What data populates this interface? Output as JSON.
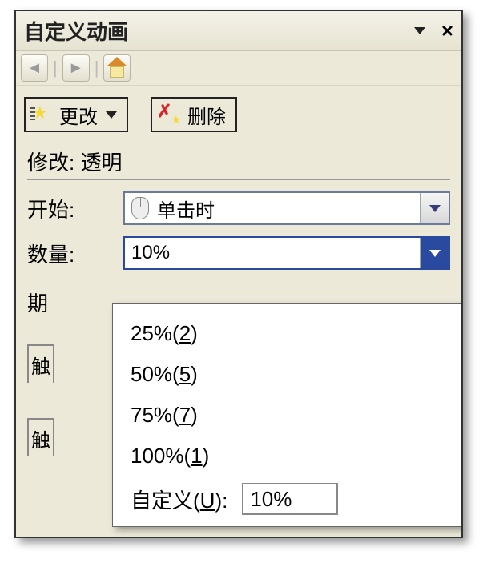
{
  "titlebar": {
    "title": "自定义动画"
  },
  "actions": {
    "change_label": "更改",
    "delete_label": "删除"
  },
  "header": {
    "modify_label": "修改:",
    "effect_name": "透明"
  },
  "fields": {
    "start_label": "开始:",
    "start_value": "单击时",
    "amount_label": "数量:",
    "amount_value": "10%",
    "duration_label_stub": "期",
    "tab_stub_1": "触",
    "tab_stub_2": "触"
  },
  "dropdown": {
    "items": [
      {
        "text": "25%(",
        "mnemonic": "2",
        "tail": ")"
      },
      {
        "text": "50%(",
        "mnemonic": "5",
        "tail": ")"
      },
      {
        "text": "75%(",
        "mnemonic": "7",
        "tail": ")"
      },
      {
        "text": "100%(",
        "mnemonic": "1",
        "tail": ")"
      }
    ],
    "custom_prefix": "自定义(",
    "custom_mnemonic": "U",
    "custom_suffix": "):",
    "custom_value": "10%"
  }
}
